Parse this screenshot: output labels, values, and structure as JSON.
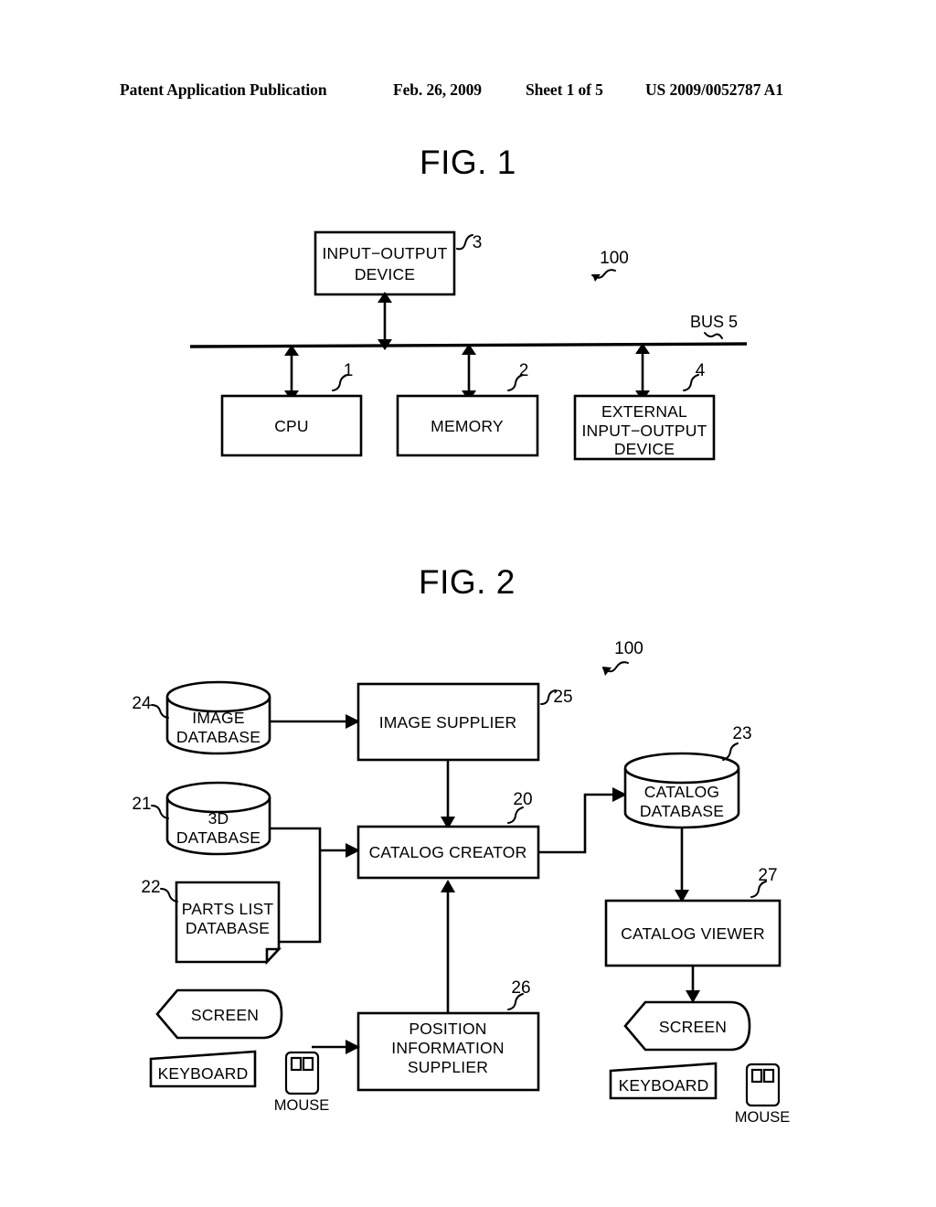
{
  "header": {
    "publication": "Patent Application Publication",
    "date": "Feb. 26, 2009",
    "sheet": "Sheet 1 of 5",
    "patent_number": "US 2009/0052787 A1"
  },
  "figures": [
    {
      "title": "FIG. 1",
      "system_ref": "100",
      "bus_label": "BUS 5",
      "nodes": [
        {
          "id": "io-device",
          "label_line1": "INPUT−OUTPUT",
          "label_line2": "DEVICE",
          "ref": "3"
        },
        {
          "id": "cpu",
          "label_line1": "CPU",
          "label_line2": "",
          "ref": "1"
        },
        {
          "id": "memory",
          "label_line1": "MEMORY",
          "label_line2": "",
          "ref": "2"
        },
        {
          "id": "external-io",
          "label_line1": "EXTERNAL",
          "label_line2": "INPUT−OUTPUT",
          "label_line3": "DEVICE",
          "ref": "4"
        }
      ]
    },
    {
      "title": "FIG. 2",
      "system_ref": "100",
      "nodes": [
        {
          "id": "image-database",
          "label_line1": "IMAGE",
          "label_line2": "DATABASE",
          "ref": "24",
          "shape": "cylinder"
        },
        {
          "id": "image-supplier",
          "label_line1": "IMAGE SUPPLIER",
          "label_line2": "",
          "ref": "25",
          "shape": "rect"
        },
        {
          "id": "3d-database",
          "label_line1": "3D",
          "label_line2": "DATABASE",
          "ref": "21",
          "shape": "cylinder"
        },
        {
          "id": "parts-list-database",
          "label_line1": "PARTS LIST",
          "label_line2": "DATABASE",
          "ref": "22",
          "shape": "document"
        },
        {
          "id": "catalog-creator",
          "label_line1": "CATALOG CREATOR",
          "label_line2": "",
          "ref": "20",
          "shape": "rect"
        },
        {
          "id": "catalog-database",
          "label_line1": "CATALOG",
          "label_line2": "DATABASE",
          "ref": "23",
          "shape": "cylinder"
        },
        {
          "id": "catalog-viewer",
          "label_line1": "CATALOG VIEWER",
          "label_line2": "",
          "ref": "27",
          "shape": "rect"
        },
        {
          "id": "position-info-supplier",
          "label_line1": "POSITION",
          "label_line2": "INFORMATION",
          "label_line3": "SUPPLIER",
          "ref": "26",
          "shape": "rect"
        },
        {
          "id": "screen-left",
          "label_line1": "SCREEN",
          "label_line2": "",
          "ref": "",
          "shape": "pentagon"
        },
        {
          "id": "keyboard-left",
          "label_line1": "KEYBOARD",
          "label_line2": "",
          "ref": "",
          "shape": "keyboard"
        },
        {
          "id": "mouse-left",
          "label_line1": "MOUSE",
          "label_line2": "",
          "ref": "",
          "shape": "mouse"
        },
        {
          "id": "screen-right",
          "label_line1": "SCREEN",
          "label_line2": "",
          "ref": "",
          "shape": "pentagon"
        },
        {
          "id": "keyboard-right",
          "label_line1": "KEYBOARD",
          "label_line2": "",
          "ref": "",
          "shape": "keyboard"
        },
        {
          "id": "mouse-right",
          "label_line1": "MOUSE",
          "label_line2": "",
          "ref": "",
          "shape": "mouse"
        }
      ]
    }
  ],
  "colors": {
    "ink": "#000000",
    "paper": "#ffffff"
  }
}
